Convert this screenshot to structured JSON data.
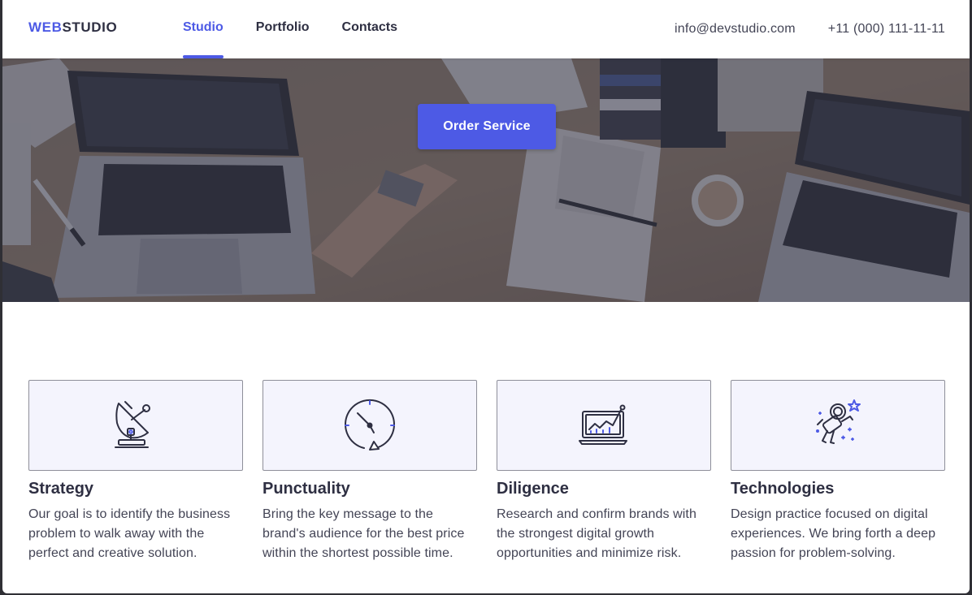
{
  "header": {
    "logo_part1": "WEB",
    "logo_part2": "STUDIO",
    "nav": [
      {
        "label": "Studio",
        "active": true
      },
      {
        "label": "Portfolio",
        "active": false
      },
      {
        "label": "Contacts",
        "active": false
      }
    ],
    "email": "info@devstudio.com",
    "phone": "+11 (000) 111-11-11"
  },
  "hero": {
    "button_label": "Order Service"
  },
  "features": [
    {
      "icon": "satellite-dish-icon",
      "title": "Strategy",
      "text": "Our goal is to identify the business problem to walk away with the perfect and creative solution."
    },
    {
      "icon": "clock-icon",
      "title": "Punctuality",
      "text": "Bring the key message to the brand's audience for the best price within the shortest possible time."
    },
    {
      "icon": "laptop-chart-icon",
      "title": "Diligence",
      "text": "Research and confirm brands with the strongest digital growth opportunities and minimize risk."
    },
    {
      "icon": "astronaut-icon",
      "title": "Technologies",
      "text": "Design practice focused on digital experiences. We bring forth a deep passion for problem-solving."
    }
  ],
  "colors": {
    "accent": "#4d5ae5",
    "text": "#2e2f42",
    "card_bg": "#f4f4fd"
  }
}
